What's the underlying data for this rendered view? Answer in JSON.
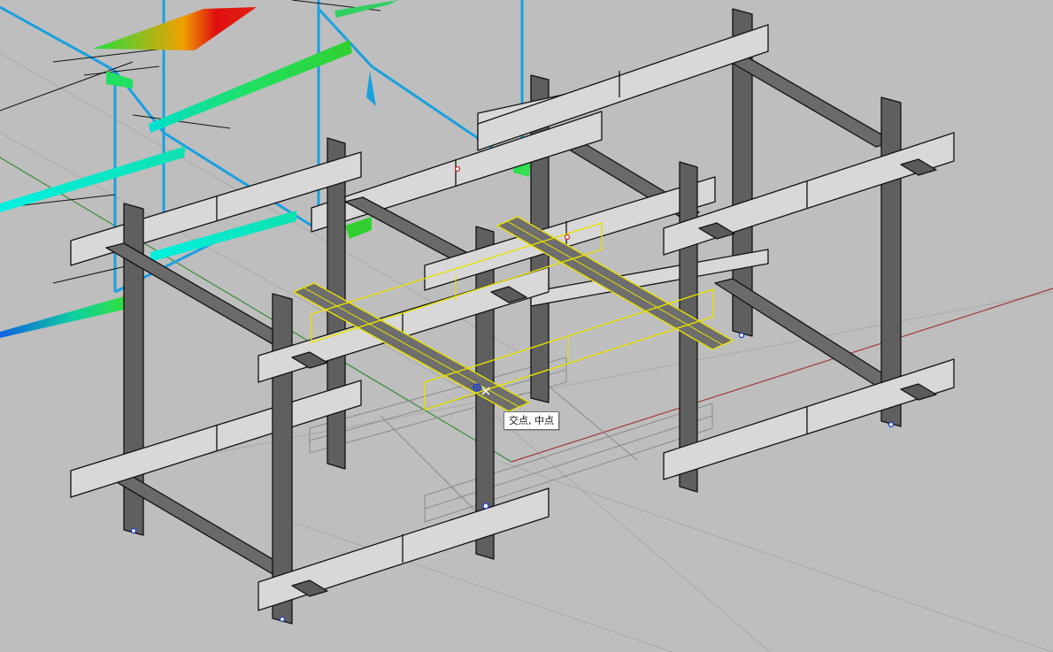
{
  "viewport": {
    "name": "perspective-3d-viewport",
    "background": "#bebebe",
    "colors": {
      "grid_line": "#a8a8a8",
      "x_axis": "#9a3a3a",
      "y_axis": "#3c8a3c",
      "beam_face_light": "#d9d9d9",
      "beam_face_dark": "#6a6a6a",
      "beam_edge": "#111111",
      "selection": "#e8e000",
      "analysis_wire": "#1aa0e0",
      "contour_low": "#00f0e0",
      "contour_mid": "#20e040",
      "contour_high": "#e01010"
    }
  },
  "tooltip": {
    "text": "交点, 中点"
  },
  "snap_marker": {
    "icon": "snap-target-icon",
    "color": "#2040d0"
  }
}
